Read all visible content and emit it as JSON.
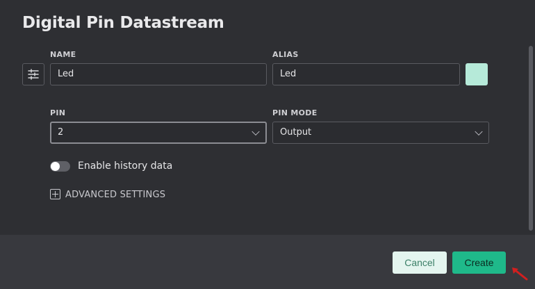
{
  "dialog": {
    "title": "Digital Pin Datastream"
  },
  "form": {
    "name_label": "NAME",
    "name_value": "Led",
    "alias_label": "ALIAS",
    "alias_value": "Led",
    "swatch_color": "#b6ead9",
    "pin_label": "PIN",
    "pin_value": "2",
    "pin_mode_label": "PIN MODE",
    "pin_mode_value": "Output",
    "history_toggle_label": "Enable history data",
    "history_enabled": false,
    "advanced_label": "ADVANCED SETTINGS"
  },
  "footer": {
    "cancel_label": "Cancel",
    "create_label": "Create"
  },
  "colors": {
    "accent": "#1fb98a",
    "background": "#2e2f33",
    "footer_background": "#38393e"
  },
  "icons": {
    "datastream_icon": "settings-sliders-icon",
    "advanced_icon": "plus-square-icon",
    "cursor": "arrow-cursor-icon"
  }
}
